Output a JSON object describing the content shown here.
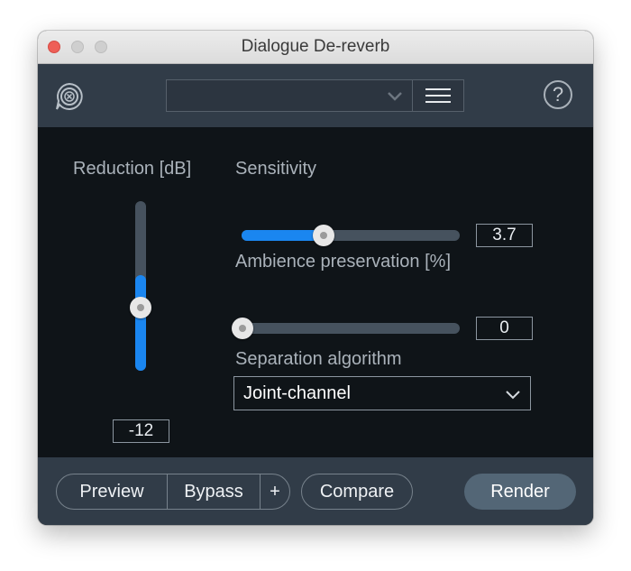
{
  "window": {
    "title": "Dialogue De-reverb"
  },
  "header": {
    "preset_value": "",
    "help_label": "?"
  },
  "controls": {
    "reduction": {
      "label": "Reduction [dB]",
      "value": "-12",
      "level": 0.56
    },
    "sensitivity": {
      "label": "Sensitivity",
      "value": "3.7",
      "level": 0.37
    },
    "ambience": {
      "label": "Ambience preservation [%]",
      "value": "0",
      "level": 0.0
    },
    "algorithm": {
      "label": "Separation algorithm",
      "value": "Joint-channel"
    }
  },
  "footer": {
    "preview": "Preview",
    "bypass": "Bypass",
    "plus": "+",
    "compare": "Compare",
    "render": "Render"
  },
  "colors": {
    "accent": "#1a86f0",
    "panel": "#313c48",
    "background": "#0f1418"
  },
  "icons": {
    "logo": "de-reverb-logo-icon",
    "preset_dropdown": "chevron-down-icon",
    "menu": "hamburger-menu-icon",
    "help": "question-mark-icon",
    "select": "chevron-down-icon"
  }
}
